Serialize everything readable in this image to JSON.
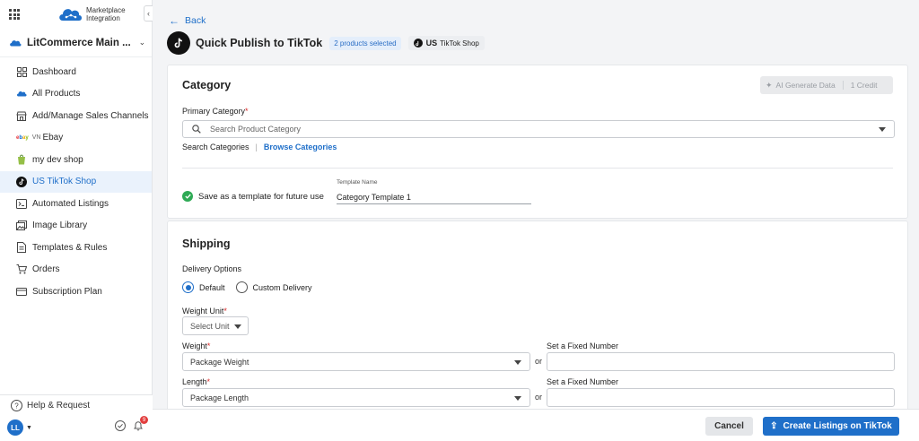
{
  "sidebar": {
    "logo_line1": "Marketplace",
    "logo_line2": "Integration",
    "store_name": "LitCommerce Main ...",
    "items": [
      {
        "label": "Dashboard",
        "icon": "dashboard-icon"
      },
      {
        "label": "All Products",
        "icon": "cloud-icon"
      },
      {
        "label": "Add/Manage Sales Channels",
        "icon": "store-icon"
      },
      {
        "label": "Ebay",
        "prefix": "VN",
        "icon": "ebay-icon"
      },
      {
        "label": "my dev shop",
        "icon": "shopify-icon"
      },
      {
        "label": "US TikTok Shop",
        "icon": "tiktok-icon"
      },
      {
        "label": "Automated Listings",
        "icon": "automation-icon"
      },
      {
        "label": "Image Library",
        "icon": "image-icon"
      },
      {
        "label": "Templates & Rules",
        "icon": "document-icon"
      },
      {
        "label": "Orders",
        "icon": "cart-icon"
      },
      {
        "label": "Subscription Plan",
        "icon": "card-icon"
      }
    ],
    "help_label": "Help & Request",
    "avatar_initials": "LL",
    "notification_count": "9"
  },
  "header": {
    "back_label": "Back",
    "title": "Quick Publish to TikTok",
    "selected_chip": "2 products selected",
    "shop_country": "US",
    "shop_name": "TikTok Shop"
  },
  "category": {
    "title": "Category",
    "ai_button_label": "AI Generate Data",
    "ai_credit": "1 Credit",
    "primary_label": "Primary Category",
    "search_placeholder": "Search Product Category",
    "search_link": "Search Categories",
    "browse_link": "Browse Categories",
    "save_template_label": "Save as a template for future use",
    "template_name_label": "Template Name",
    "template_name_value": "Category Template 1"
  },
  "shipping": {
    "title": "Shipping",
    "delivery_label": "Delivery Options",
    "option_default": "Default",
    "option_custom": "Custom Delivery",
    "weight_unit_label": "Weight Unit",
    "weight_unit_placeholder": "Select Unit",
    "weight_label": "Weight",
    "weight_value": "Package Weight",
    "length_label": "Length",
    "length_value": "Package Length",
    "or_label": "or",
    "fixed_label": "Set a Fixed Number"
  },
  "footer": {
    "cancel_label": "Cancel",
    "create_label": "Create Listings on TikTok"
  },
  "colors": {
    "accent": "#1f6fc9",
    "success": "#2eaa55",
    "required": "#d92b2b"
  }
}
